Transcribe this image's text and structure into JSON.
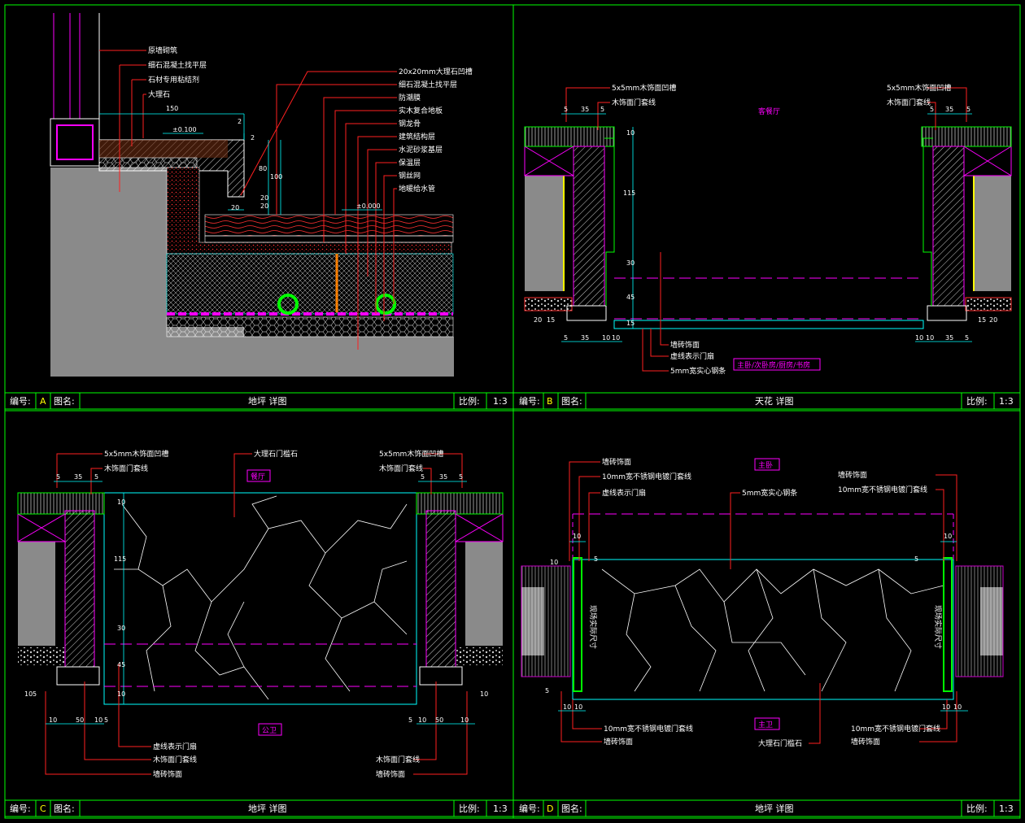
{
  "colors": {
    "frame": "#00ff00",
    "line": "#00ffff",
    "text": "#ffffff",
    "leader": "#ff2020",
    "dash": "#ff00ff",
    "hatch": "#8a8a8a",
    "stone": "#ff3030",
    "pipe": "#00ff00"
  },
  "panels": {
    "A": {
      "number_label": "编号:",
      "number": "A",
      "name_label": "图名:",
      "name": "地坪 详图",
      "scale_label": "比例:",
      "scale": "1:3",
      "left_labels": [
        "原墙砌筑",
        "细石混凝土找平层",
        "石材专用粘结剂",
        "大理石"
      ],
      "right_labels": [
        "20x20mm大理石凹槽",
        "细石混凝土找平层",
        "防潮膜",
        "实木复合地板",
        "钢龙骨",
        "建筑结构层",
        "水泥砂浆基层",
        "保温层",
        "钢丝网",
        "地暖给水管"
      ],
      "dims": [
        "150",
        "2",
        "20",
        "20",
        "100",
        "80",
        "2",
        "20"
      ],
      "levels": [
        "±0.100",
        "±0.000"
      ]
    },
    "B": {
      "number_label": "编号:",
      "number": "B",
      "name_label": "图名:",
      "name": "天花 详图",
      "scale_label": "比例:",
      "scale": "1:3",
      "left_labels": [
        "5x5mm木饰面凹槽",
        "木饰面门套线"
      ],
      "right_labels": [
        "5x5mm木饰面凹槽",
        "木饰面门套线"
      ],
      "room": "客餐厅",
      "bottom_labels": [
        "墙砖饰面",
        "虚线表示门扇",
        "5mm宽实心钢条"
      ],
      "rooms_bottom": "主卧/次卧房/厨房/书房",
      "dims_top_left": [
        "5",
        "35",
        "5"
      ],
      "dims_top_right": [
        "5",
        "35",
        "5"
      ],
      "dims_vertical": [
        "10",
        "115",
        "30",
        "45",
        "15"
      ],
      "dims_bottom_left": [
        "5",
        "35",
        "10",
        "10"
      ],
      "dims_bottom_right": [
        "10",
        "10",
        "35",
        "5"
      ],
      "dims_side_left": [
        "20",
        "15"
      ],
      "dims_side_right": [
        "15",
        "20"
      ]
    },
    "C": {
      "number_label": "编号:",
      "number": "C",
      "name_label": "图名:",
      "name": "地坪 详图",
      "scale_label": "比例:",
      "scale": "1:3",
      "top_left_labels": [
        "5x5mm木饰面凹槽",
        "木饰面门套线"
      ],
      "top_center_label": "大理石门槛石",
      "top_right_labels": [
        "5x5mm木饰面凹槽",
        "木饰面门套线"
      ],
      "room_top": "餐厅",
      "room_bottom": "公卫",
      "bottom_left_labels": [
        "虚线表示门扇",
        "木饰面门套线",
        "墙砖饰面"
      ],
      "bottom_right_labels": [
        "木饰面门套线",
        "墙砖饰面"
      ],
      "dims_top_left": [
        "5",
        "35",
        "5"
      ],
      "dims_top_right": [
        "5",
        "35",
        "5"
      ],
      "dims_vertical": [
        "10",
        "115",
        "30",
        "45",
        "10"
      ],
      "dims_bottom_left": [
        "10",
        "50",
        "10",
        "5"
      ],
      "dims_bottom_right": [
        "10",
        "50",
        "10",
        "5"
      ],
      "dims_side": [
        "10",
        "5",
        "10"
      ]
    },
    "D": {
      "number_label": "编号:",
      "number": "D",
      "name_label": "图名:",
      "name": "地坪 详图",
      "scale_label": "比例:",
      "scale": "1:3",
      "top_left_labels": [
        "墙砖饰面",
        "10mm宽不锈钢电镀门套线",
        "虚线表示门扇"
      ],
      "top_center_label": "5mm宽实心钢条",
      "top_right_labels": [
        "墙砖饰面",
        "10mm宽不锈钢电镀门套线"
      ],
      "room_top": "主卧",
      "room_bottom": "主卫",
      "bottom_left_labels": [
        "10mm宽不锈钢电镀门套线",
        "墙砖饰面"
      ],
      "bottom_center_label": "大理石门槛石",
      "bottom_right_labels": [
        "10mm宽不锈钢电镀门套线",
        "墙砖饰面"
      ],
      "vertical_note": "现场实际尺寸",
      "dims_top": [
        "10",
        "10"
      ],
      "dims_side": [
        "10",
        "5"
      ],
      "dims_bottom": [
        "10",
        "10",
        "10",
        "10"
      ],
      "dims_inner": [
        "5",
        "5"
      ]
    }
  }
}
